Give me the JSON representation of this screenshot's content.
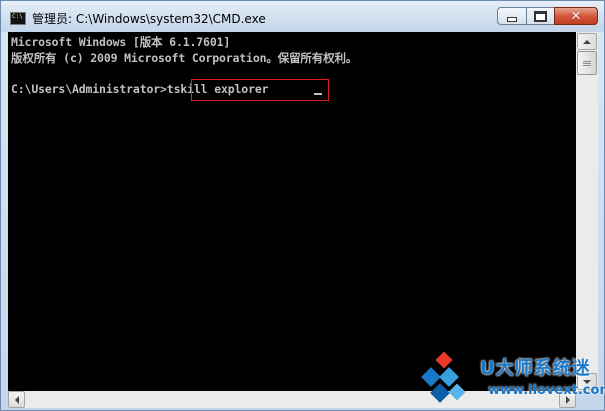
{
  "window": {
    "title": "管理员: C:\\Windows\\system32\\CMD.exe",
    "app_icon": "cmd-icon"
  },
  "caption_buttons": {
    "minimize_icon": "minimize-icon",
    "maximize_icon": "maximize-icon",
    "close_icon": "close-icon",
    "close_glyph": "✕"
  },
  "console": {
    "lines": [
      "Microsoft Windows [版本 6.1.7601]",
      "版权所有 (c) 2009 Microsoft Corporation。保留所有权利。",
      "",
      "C:\\Users\\Administrator>tskill explorer"
    ],
    "text_color": "#c0c0c0",
    "background": "#000000",
    "highlight_color": "#e02020"
  },
  "watermark": {
    "brand": "U大师系统迷",
    "url": "www.ilovext.com"
  }
}
